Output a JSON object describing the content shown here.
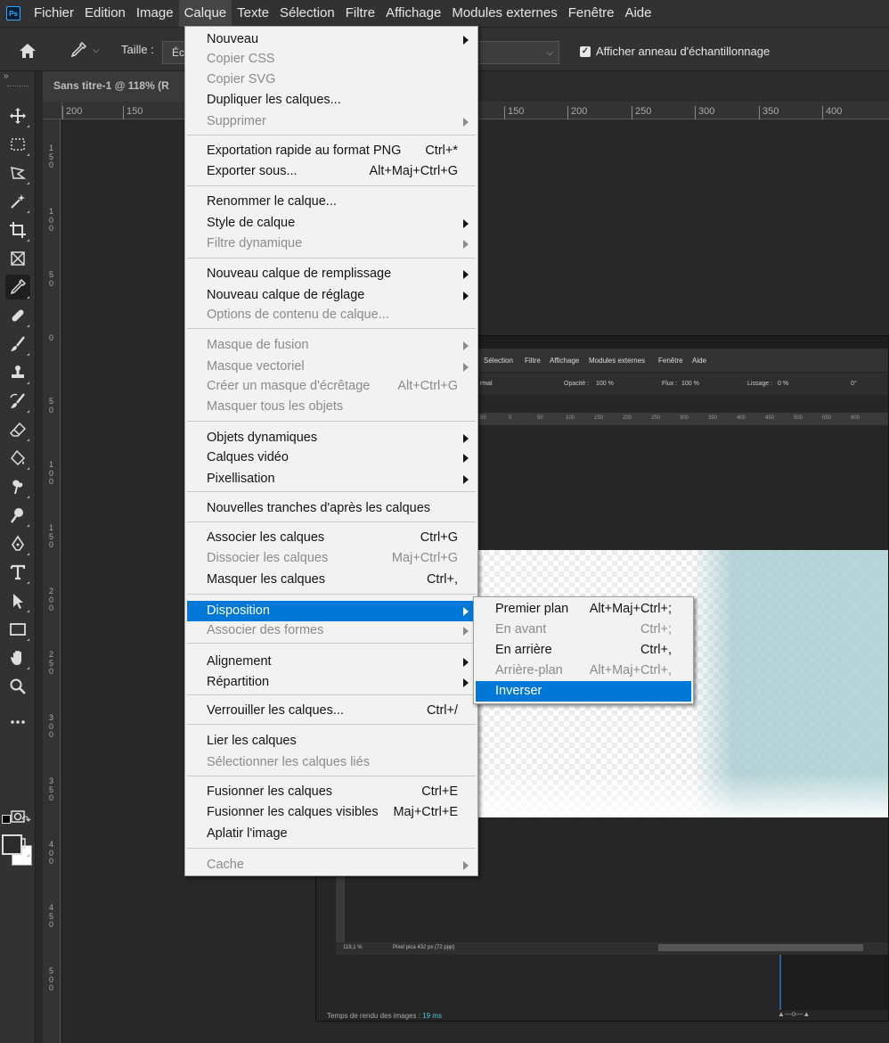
{
  "app": {
    "logo_text": "Ps"
  },
  "menubar": {
    "items": [
      "Fichier",
      "Edition",
      "Image",
      "Calque",
      "Texte",
      "Sélection",
      "Filtre",
      "Affichage",
      "Modules externes",
      "Fenêtre",
      "Aide"
    ],
    "open_item": "Calque"
  },
  "options_bar": {
    "size_label": "Taille :",
    "size_value": "Éc",
    "show_sampling_ring_label": "Afficher anneau d'échantillonnage",
    "show_sampling_ring_checked": true
  },
  "document": {
    "tab_title": "Sans titre-1 @ 118% (R"
  },
  "ruler": {
    "top_ticks": [
      "200",
      "150",
      "150",
      "200",
      "250",
      "300",
      "350",
      "400"
    ],
    "left_ticks": [
      "150",
      "100",
      "50",
      "0",
      "50",
      "100",
      "150",
      "200",
      "250",
      "300",
      "350",
      "400",
      "450",
      "500"
    ]
  },
  "layer_menu": {
    "items": [
      {
        "label": "Nouveau",
        "submenu": true,
        "disabled": false
      },
      {
        "label": "Copier CSS",
        "disabled": true
      },
      {
        "label": "Copier SVG",
        "disabled": true
      },
      {
        "label": "Dupliquer les calques...",
        "disabled": false
      },
      {
        "label": "Supprimer",
        "submenu": true,
        "disabled": true
      },
      {
        "label": "Exportation rapide au format PNG",
        "shortcut": "Ctrl+*",
        "disabled": false
      },
      {
        "label": "Exporter sous...",
        "shortcut": "Alt+Maj+Ctrl+G",
        "disabled": false
      },
      {
        "label": "Renommer le calque...",
        "disabled": false
      },
      {
        "label": "Style de calque",
        "submenu": true,
        "disabled": false
      },
      {
        "label": "Filtre dynamique",
        "submenu": true,
        "disabled": true
      },
      {
        "label": "Nouveau calque de remplissage",
        "submenu": true,
        "disabled": false
      },
      {
        "label": "Nouveau calque de réglage",
        "submenu": true,
        "disabled": false
      },
      {
        "label": "Options de contenu de calque...",
        "disabled": true
      },
      {
        "label": "Masque de fusion",
        "submenu": true,
        "disabled": true
      },
      {
        "label": "Masque vectoriel",
        "submenu": true,
        "disabled": true
      },
      {
        "label": "Créer un masque d'écrêtage",
        "shortcut": "Alt+Ctrl+G",
        "disabled": true
      },
      {
        "label": "Masquer tous les objets",
        "disabled": true
      },
      {
        "label": "Objets dynamiques",
        "submenu": true,
        "disabled": false
      },
      {
        "label": "Calques vidéo",
        "submenu": true,
        "disabled": false
      },
      {
        "label": "Pixellisation",
        "submenu": true,
        "disabled": false
      },
      {
        "label": "Nouvelles tranches d'après les calques",
        "disabled": false
      },
      {
        "label": "Associer les calques",
        "shortcut": "Ctrl+G",
        "disabled": false
      },
      {
        "label": "Dissocier les calques",
        "shortcut": "Maj+Ctrl+G",
        "disabled": true
      },
      {
        "label": "Masquer les calques",
        "shortcut": "Ctrl+,",
        "disabled": false
      },
      {
        "label": "Disposition",
        "submenu": true,
        "disabled": false,
        "highlighted": true
      },
      {
        "label": "Associer des formes",
        "submenu": true,
        "disabled": true
      },
      {
        "label": "Alignement",
        "submenu": true,
        "disabled": false
      },
      {
        "label": "Répartition",
        "submenu": true,
        "disabled": false
      },
      {
        "label": "Verrouiller les calques...",
        "shortcut": "Ctrl+/",
        "disabled": false
      },
      {
        "label": "Lier les calques",
        "disabled": false
      },
      {
        "label": "Sélectionner les calques liés",
        "disabled": true
      },
      {
        "label": "Fusionner les calques",
        "shortcut": "Ctrl+E",
        "disabled": false
      },
      {
        "label": "Fusionner les calques visibles",
        "shortcut": "Maj+Ctrl+E",
        "disabled": false
      },
      {
        "label": "Aplatir l'image",
        "disabled": false
      },
      {
        "label": "Cache",
        "submenu": true,
        "disabled": true
      }
    ]
  },
  "arrange_submenu": {
    "items": [
      {
        "label": "Premier plan",
        "shortcut": "Alt+Maj+Ctrl+;",
        "disabled": false
      },
      {
        "label": "En avant",
        "shortcut": "Ctrl+;",
        "disabled": true
      },
      {
        "label": "En arrière",
        "shortcut": "Ctrl+,",
        "disabled": false
      },
      {
        "label": "Arrière-plan",
        "shortcut": "Alt+Maj+Ctrl+,",
        "disabled": true
      },
      {
        "label": "Inverser",
        "disabled": false,
        "highlighted": true
      }
    ]
  },
  "embedded": {
    "menu": [
      "Sélection",
      "Filtre",
      "Affichage",
      "Modules externes",
      "Fenêtre",
      "Aide"
    ],
    "opts": [
      "rmal",
      "Opacité :",
      "100 %",
      "Flux :",
      "100 %",
      "Lissage :",
      "0 %",
      "0°"
    ],
    "ruler": [
      "50",
      "0",
      "50",
      "100",
      "150",
      "200",
      "250",
      "300",
      "350",
      "400",
      "450",
      "500",
      "550",
      "600"
    ],
    "status_zoom": "118,1 %",
    "status_info": "Pixel pica 432 px (72 ppp)",
    "render_label": "Temps de rendu des images :",
    "render_value": "19 ms"
  },
  "colors": {
    "menu_highlight": "#0078d7",
    "app_bg": "#282828",
    "menu_bg": "#f2f2f2"
  }
}
